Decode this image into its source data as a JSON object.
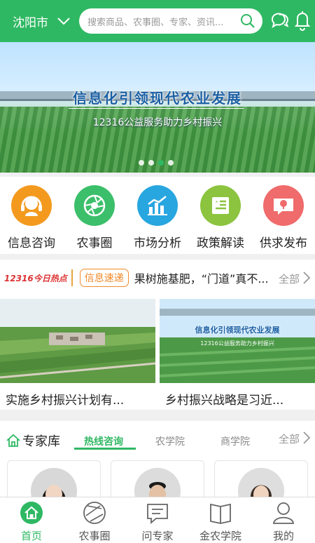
{
  "header": {
    "city": "沈阳市",
    "search_placeholder": "搜索商品、农事圈、专家、资讯...",
    "icons": [
      "chevron-down-icon",
      "search-icon",
      "message-icon",
      "bell-icon"
    ],
    "color": "#2fb863"
  },
  "banner": {
    "title": "信息化引领现代农业发展",
    "subtitle": "12316公益服务助力乡村振兴",
    "slide_count": 4,
    "active_slide": 3
  },
  "quick_menu": [
    {
      "label": "信息咨询",
      "icon": "headset-icon",
      "color": "#f39a1e"
    },
    {
      "label": "农事圈",
      "icon": "aperture-icon",
      "color": "#3cbf6a"
    },
    {
      "label": "市场分析",
      "icon": "bar-chart-icon",
      "color": "#28a6e0"
    },
    {
      "label": "政策解读",
      "icon": "document-icon",
      "color": "#8cc43f"
    },
    {
      "label": "供求发布",
      "icon": "chat-tree-icon",
      "color": "#f06b6b"
    }
  ],
  "news": {
    "brand": "12316今日热点",
    "tag": "信息速递",
    "headline": "果树施基肥，“门道”真不...",
    "more": "全部",
    "cards": [
      {
        "caption": "实施乡村振兴计划有..."
      },
      {
        "caption": "乡村振兴战略是习近..."
      }
    ],
    "card2_title": "信息化引领现代农业发展",
    "card2_subtitle": "12316公益服务助力乡村振兴"
  },
  "experts": {
    "title": "专家库",
    "tabs": [
      "热线咨询",
      "农学院",
      "商学院"
    ],
    "active_tab": 0,
    "more": "全部"
  },
  "tabbar": [
    {
      "label": "首页",
      "icon": "home-icon",
      "active": true
    },
    {
      "label": "农事圈",
      "icon": "aperture-icon",
      "active": false
    },
    {
      "label": "问专家",
      "icon": "chat-bubble-icon",
      "active": false
    },
    {
      "label": "金农学院",
      "icon": "book-icon",
      "active": false
    },
    {
      "label": "我的",
      "icon": "user-icon",
      "active": false
    }
  ]
}
